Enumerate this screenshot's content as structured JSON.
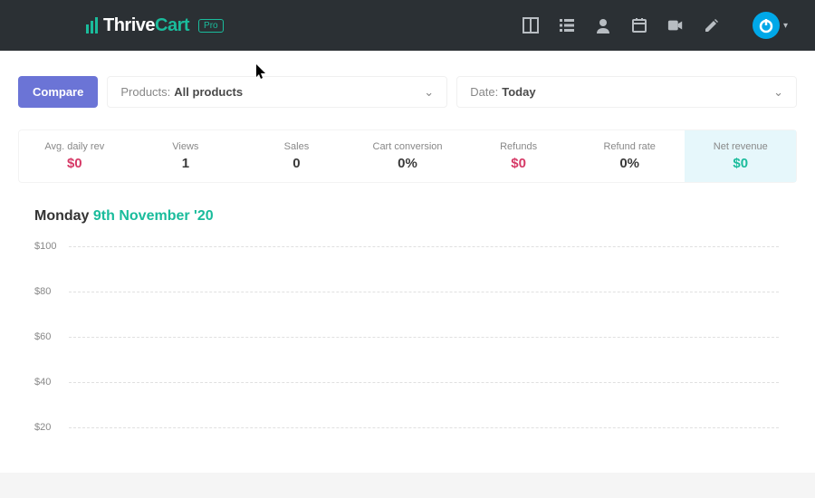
{
  "brand": {
    "name_part1": "Thrive",
    "name_part2": "Cart",
    "badge": "Pro"
  },
  "topbar_icons": [
    "dashboard-icon",
    "list-icon",
    "user-icon",
    "calendar-icon",
    "video-icon",
    "edit-icon"
  ],
  "filters": {
    "compare_label": "Compare",
    "products_label": "Products:",
    "products_value": "All products",
    "date_label": "Date:",
    "date_value": "Today"
  },
  "stats": [
    {
      "label": "Avg. daily rev",
      "value": "$0",
      "class": "green"
    },
    {
      "label": "Views",
      "value": "1",
      "class": "dark"
    },
    {
      "label": "Sales",
      "value": "0",
      "class": "dark"
    },
    {
      "label": "Cart conversion",
      "value": "0%",
      "class": "dark"
    },
    {
      "label": "Refunds",
      "value": "$0",
      "class": "green"
    },
    {
      "label": "Refund rate",
      "value": "0%",
      "class": "dark"
    },
    {
      "label": "Net revenue",
      "value": "$0",
      "class": "teal",
      "active": true
    }
  ],
  "chart_title": {
    "day": "Monday",
    "date": "9th November '20"
  },
  "chart_data": {
    "type": "line",
    "title": "Monday 9th November '20",
    "xlabel": "",
    "ylabel": "",
    "ylim": [
      0,
      100
    ],
    "yticks": [
      20,
      40,
      60,
      80,
      100
    ],
    "ytick_labels": [
      "$20",
      "$40",
      "$60",
      "$80",
      "$100"
    ],
    "series": [
      {
        "name": "Net revenue",
        "values": []
      }
    ]
  }
}
